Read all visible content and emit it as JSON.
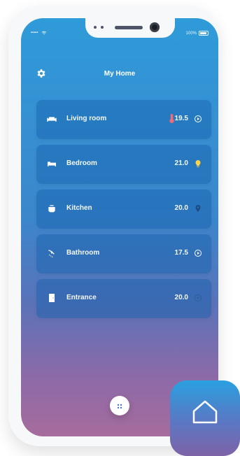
{
  "statusbar": {
    "signal": "•••••",
    "wifi": "wifi-icon",
    "battery_text": "100%"
  },
  "header": {
    "title": "My Home",
    "settings_icon": "gear-icon"
  },
  "rooms": [
    {
      "name": "Living room",
      "value": "19.5",
      "device_icon": "sofa-icon",
      "status_icon": "play-circle-icon",
      "badge_icon": "thermometer-icon"
    },
    {
      "name": "Bedroom",
      "value": "21.0",
      "device_icon": "bed-icon",
      "status_icon": "lightbulb-icon"
    },
    {
      "name": "Kitchen",
      "value": "20.0",
      "device_icon": "pot-icon",
      "status_icon": "location-pin-icon"
    },
    {
      "name": "Bathroom",
      "value": "17.5",
      "device_icon": "shower-icon",
      "status_icon": "play-circle-icon"
    },
    {
      "name": "Entrance",
      "value": "20.0",
      "device_icon": "door-icon",
      "status_icon": "play-circle-icon"
    }
  ],
  "actions": {
    "fab_icon": "grid-dots-icon",
    "home_icon": "home-icon"
  },
  "colors": {
    "gradient_top": "#2f9bd9",
    "gradient_bottom": "#a66c9c",
    "card_fill": "#1a5ea9",
    "accent_yellow": "#ffd54a",
    "accent_red": "#f26b74",
    "accent_dark": "#1d4b85"
  }
}
